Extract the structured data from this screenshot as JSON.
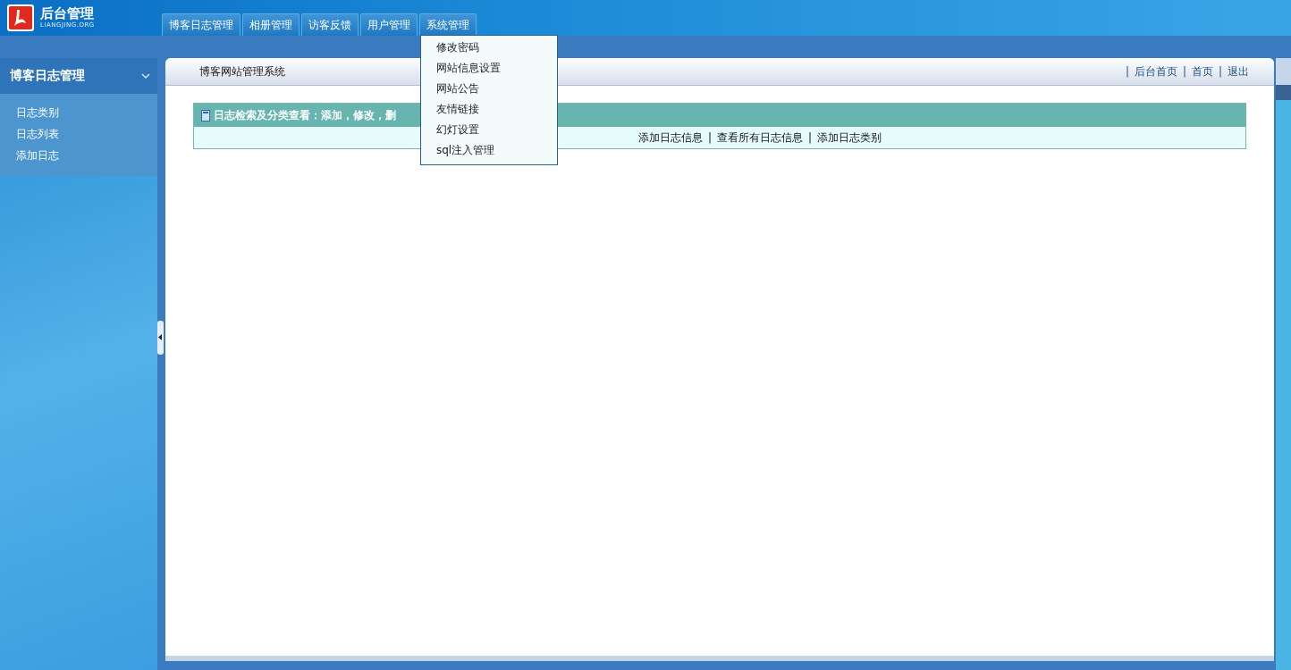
{
  "logo": {
    "title": "后台管理",
    "subtitle": "LIANGJING.ORG"
  },
  "tabs": [
    {
      "label": "博客日志管理"
    },
    {
      "label": "相册管理"
    },
    {
      "label": "访客反馈"
    },
    {
      "label": "用户管理"
    },
    {
      "label": "系统管理"
    }
  ],
  "dropdown_menu": {
    "items": [
      "修改密码",
      "网站信息设置",
      "网站公告",
      "友情链接",
      "幻灯设置",
      "sql注入管理"
    ]
  },
  "sidebar": {
    "title": "博客日志管理",
    "items": [
      "日志类别",
      "日志列表",
      "添加日志"
    ]
  },
  "content": {
    "title": "博客网站管理系统",
    "top_links": {
      "separator": "|",
      "items": [
        "后台首页",
        "首页",
        "退出"
      ]
    },
    "panel": {
      "title": "日志检索及分类查看：添加，修改，删",
      "actions": {
        "separator": "|",
        "items": [
          "添加日志信息",
          "查看所有日志信息",
          "添加日志类别"
        ]
      }
    }
  }
}
